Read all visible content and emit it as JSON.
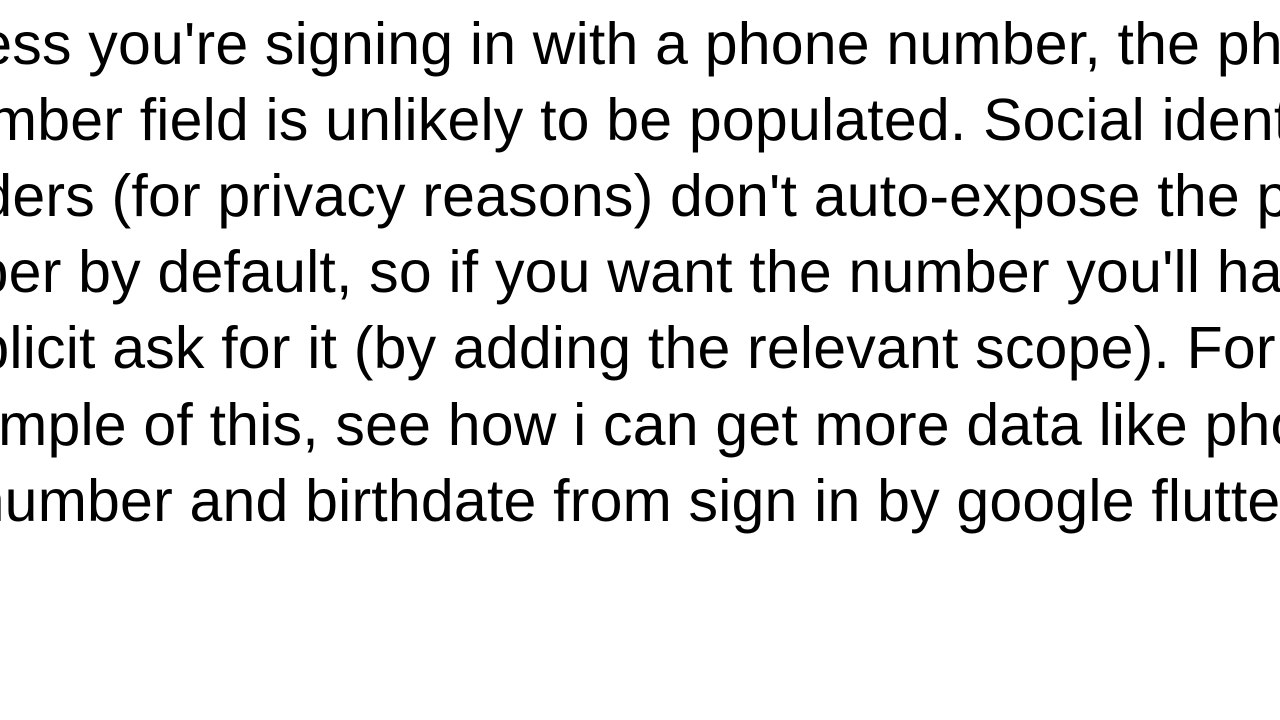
{
  "text": {
    "part1": "Unless you're signing in with a phone number, the phone number field is unlikely to be populated. Social identity providers (for privacy reasons) don't auto-expose the phone number by default, so if you want the number you'll have to explicit ask for it (by adding the relevant scope). For an example of this, see ",
    "link": "how i can get more data like phone number and birthdate from sign in by google flutter"
  }
}
